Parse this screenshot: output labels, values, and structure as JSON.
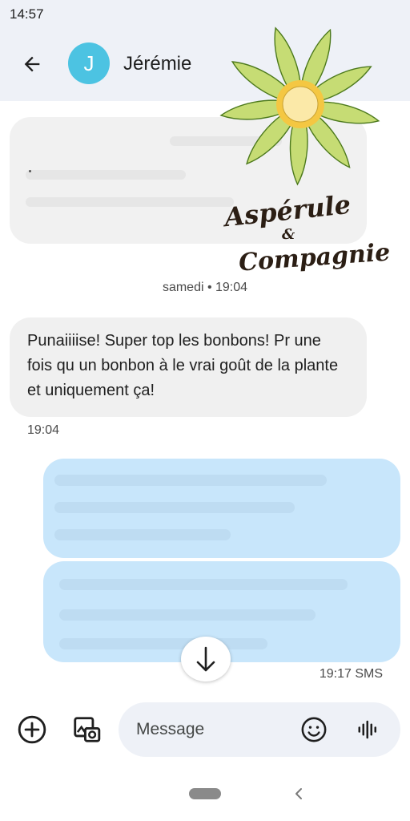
{
  "status_bar": {
    "time": "14:57"
  },
  "header": {
    "avatar_initial": "J",
    "contact_name": "Jérémie"
  },
  "thread": {
    "date_separator": "samedi • 19:04",
    "incoming_message": "Punaiiiise! Super top les bonbons! Pr une fois qu un bonbon à le vrai goût de la plante et uniquement ça!",
    "incoming_time": "19:04",
    "outgoing_meta": "19:17 SMS"
  },
  "compose": {
    "placeholder": "Message"
  },
  "watermark": {
    "line1": "Aspérule",
    "amp": "&",
    "line2": "Compagnie"
  },
  "colors": {
    "incoming_bubble": "#f0f0f0",
    "outgoing_bubble": "#c8e6fb",
    "avatar": "#4cc3e2",
    "header_bg": "#eef1f7"
  },
  "icons": [
    "arrow-back-icon",
    "add-circle-icon",
    "gallery-icon",
    "emoji-icon",
    "voice-wave-icon",
    "arrow-down-icon",
    "nav-back-icon"
  ]
}
